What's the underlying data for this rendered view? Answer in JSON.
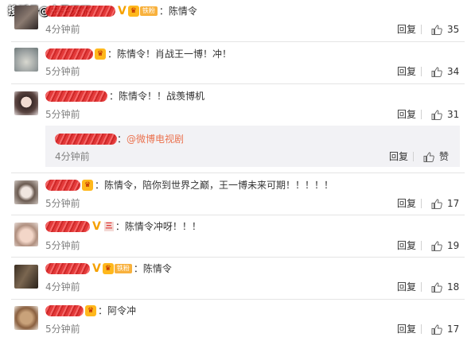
{
  "watermark": "搜狐号@虫子天下",
  "comments": [
    {
      "time": "4分钟前",
      "text": "：陈情令",
      "reply": "回复",
      "likes": "35"
    },
    {
      "time": "5分钟前",
      "text": "：陈情令！肖战王一博！冲！",
      "reply": "回复",
      "likes": "34"
    },
    {
      "time": "5分钟前",
      "text": "：陈情令！！战羡博机",
      "reply": "回复",
      "likes": "31",
      "sub": {
        "prefix": "：",
        "link": "@微博电视剧",
        "time": "4分钟前",
        "reply": "回复",
        "like_label": "赞"
      }
    },
    {
      "time": "5分钟前",
      "text": "：陈情令，陪你到世界之巅，王一博未来可期！！！！！",
      "reply": "回复",
      "likes": "17"
    },
    {
      "time": "5分钟前",
      "text": "：陈情令冲呀！！！",
      "reply": "回复",
      "likes": "19"
    },
    {
      "time": "4分钟前",
      "text": "：陈情令",
      "reply": "回复",
      "likes": "18"
    },
    {
      "time": "5分钟前",
      "text": "：阿令冲",
      "reply": "回复",
      "likes": "17"
    }
  ],
  "badges": {
    "fan": "铁粉",
    "vip": "♛",
    "lv": "三",
    "v": "V"
  },
  "colors": {
    "accent_link": "#eb7350",
    "muted": "#808080",
    "redaction": "#e02424"
  }
}
